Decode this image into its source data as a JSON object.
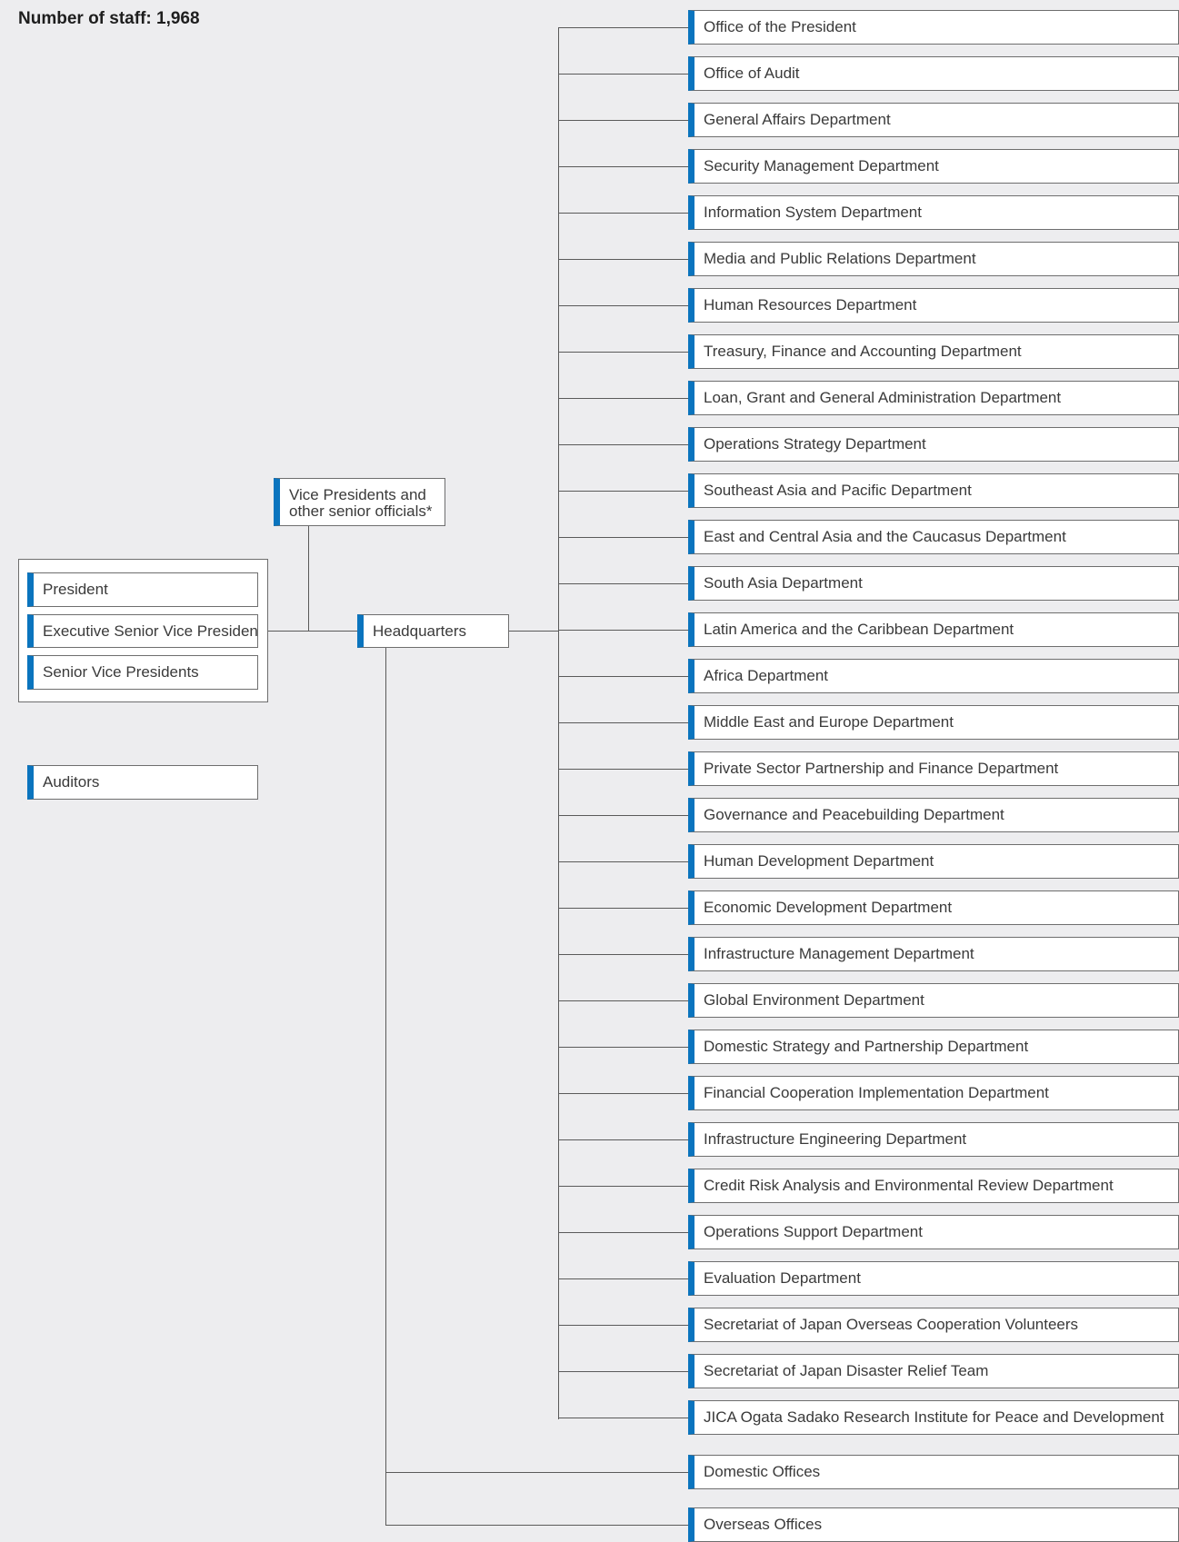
{
  "header": {
    "staff_label": "Number of staff: 1,968"
  },
  "executives": {
    "president": "President",
    "executive_senior_vice_president": "Executive Senior Vice President",
    "senior_vice_presidents": "Senior Vice Presidents"
  },
  "auditors": "Auditors",
  "vice_presidents": "Vice Presidents and other senior officials*",
  "headquarters": "Headquarters",
  "departments": [
    "Office of the President",
    "Office of Audit",
    "General Affairs Department",
    "Security Management Department",
    "Information System Department",
    "Media and Public Relations Department",
    "Human Resources Department",
    "Treasury, Finance and Accounting Department",
    "Loan, Grant and General Administration Department",
    "Operations Strategy Department",
    "Southeast Asia and Pacific Department",
    "East and Central Asia and the Caucasus Department",
    "South Asia Department",
    "Latin America and the Caribbean Department",
    "Africa Department",
    "Middle East and Europe Department",
    "Private Sector Partnership and Finance Department",
    "Governance and Peacebuilding Department",
    "Human Development Department",
    "Economic Development Department",
    "Infrastructure Management Department",
    "Global Environment Department",
    "Domestic Strategy and Partnership Department",
    "Financial Cooperation Implementation Department",
    "Infrastructure Engineering Department",
    "Credit Risk Analysis and Environmental Review Department",
    "Operations Support Department",
    "Evaluation Department",
    "Secretariat of Japan Overseas Cooperation Volunteers",
    "Secretariat of Japan Disaster Relief Team",
    "JICA Ogata Sadako Research Institute for Peace and Development"
  ],
  "offices": [
    "Domestic Offices",
    "Overseas Offices"
  ],
  "colors": {
    "accent": "#0a74be",
    "background": "#ededef",
    "line": "#5a5a5a"
  }
}
